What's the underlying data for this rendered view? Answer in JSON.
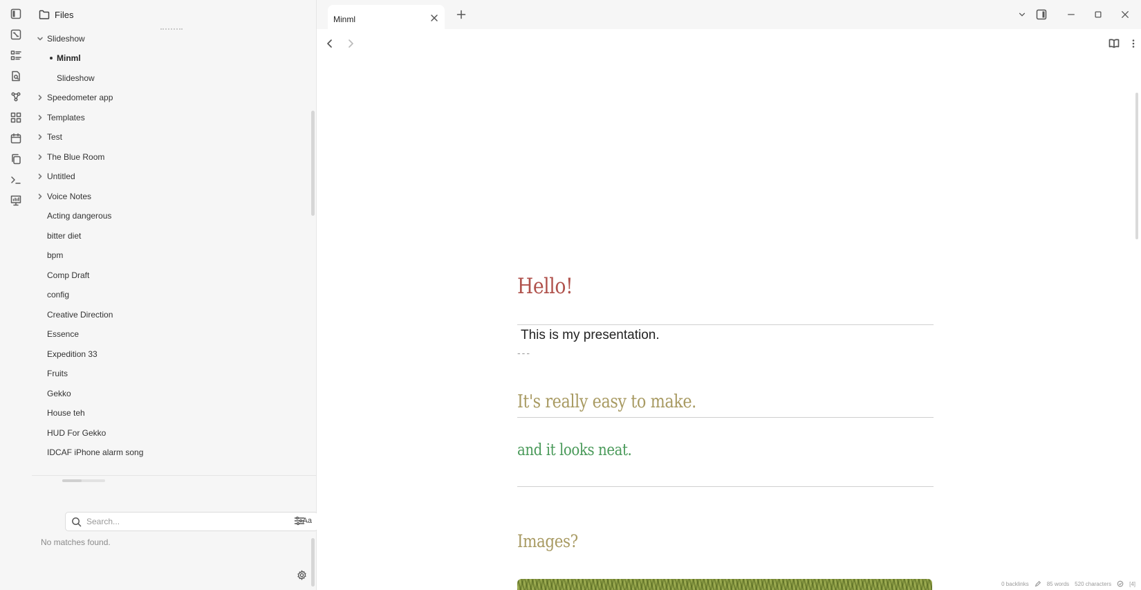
{
  "sidebar": {
    "title": "Files",
    "items": [
      {
        "label": "Slideshow",
        "type": "folder",
        "expanded": true
      },
      {
        "label": "Minml",
        "type": "file",
        "active": true
      },
      {
        "label": "Slideshow",
        "type": "file"
      },
      {
        "label": "Speedometer app",
        "type": "folder"
      },
      {
        "label": "Templates",
        "type": "folder"
      },
      {
        "label": "Test",
        "type": "folder"
      },
      {
        "label": "The Blue Room",
        "type": "folder"
      },
      {
        "label": "Untitled",
        "type": "folder"
      },
      {
        "label": "Voice Notes",
        "type": "folder"
      },
      {
        "label": "Acting dangerous",
        "type": "file"
      },
      {
        "label": "bitter diet",
        "type": "file"
      },
      {
        "label": "bpm",
        "type": "file"
      },
      {
        "label": "Comp Draft",
        "type": "file"
      },
      {
        "label": "config",
        "type": "file"
      },
      {
        "label": "Creative Direction",
        "type": "file"
      },
      {
        "label": "Essence",
        "type": "file"
      },
      {
        "label": "Expedition 33",
        "type": "file"
      },
      {
        "label": "Fruits",
        "type": "file"
      },
      {
        "label": "Gekko",
        "type": "file"
      },
      {
        "label": "House teh",
        "type": "file"
      },
      {
        "label": "HUD For Gekko",
        "type": "file"
      },
      {
        "label": "IDCAF iPhone alarm song",
        "type": "file"
      }
    ]
  },
  "search": {
    "placeholder": "Search...",
    "value": "",
    "match_case_label": "Aa",
    "no_results": "No matches found."
  },
  "tabs": [
    {
      "label": "Minml",
      "active": true
    }
  ],
  "note": {
    "heading1": "Hello!",
    "paragraph": "This is my presentation.",
    "separator": "---",
    "heading2": "It's really easy to make.",
    "heading3": "and it looks neat.",
    "heading4": "Images?"
  },
  "status_bar": {
    "backlinks": "0 backlinks",
    "words": "85 words",
    "characters": "520 characters",
    "extra": "[4]"
  },
  "colors": {
    "heading1": "#b0524c",
    "heading2": "#a89a62",
    "heading3": "#4a9a5a",
    "sidebar_bg": "#f6f6f6"
  }
}
